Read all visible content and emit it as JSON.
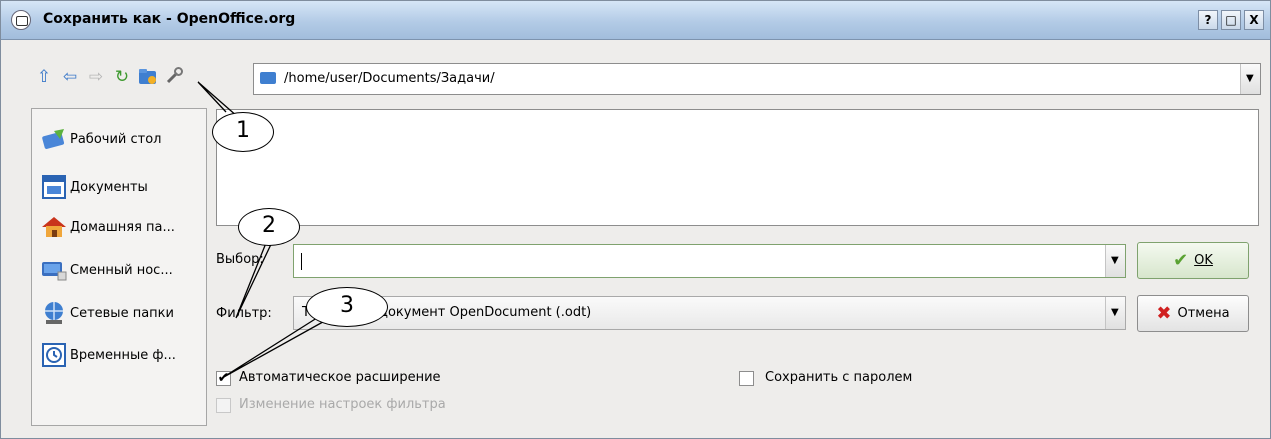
{
  "window": {
    "title": "Сохранить как - OpenOffice.org",
    "controls": [
      "?",
      "□",
      "X"
    ]
  },
  "toolbar": {
    "icons": [
      "up-icon",
      "back-icon",
      "forward-icon",
      "reload-icon",
      "new-folder-icon",
      "configure-wrench-icon"
    ],
    "path": "/home/user/Documents/Задачи/"
  },
  "sidebar": {
    "items": [
      {
        "icon": "desktop-icon",
        "label": "Рабочий стол"
      },
      {
        "icon": "documents-icon",
        "label": "Документы"
      },
      {
        "icon": "home-icon",
        "label": "Домашняя па..."
      },
      {
        "icon": "removable-media-icon",
        "label": "Сменный нос..."
      },
      {
        "icon": "network-folders-icon",
        "label": "Сетевые папки"
      },
      {
        "icon": "temporary-files-icon",
        "label": "Временные ф..."
      }
    ]
  },
  "form": {
    "selection_label": "Выбор:",
    "selection_value": "",
    "filter_label": "Фильтр:",
    "filter_value": "Текстовый документ OpenDocument (.odt)"
  },
  "buttons": {
    "ok": "OK",
    "cancel": "Отмена"
  },
  "options": {
    "auto_extension": {
      "label": "Автоматическое расширение",
      "checked": true
    },
    "save_with_password": {
      "label": "Сохранить с паролем",
      "checked": false
    },
    "edit_filter_settings": {
      "label": "Изменение настроек фильтра",
      "checked": false,
      "disabled": true
    }
  },
  "callouts": [
    "1",
    "2",
    "3"
  ],
  "colors": {
    "titlebar": "#b3cbe6",
    "accent_green": "#7fa26e"
  }
}
